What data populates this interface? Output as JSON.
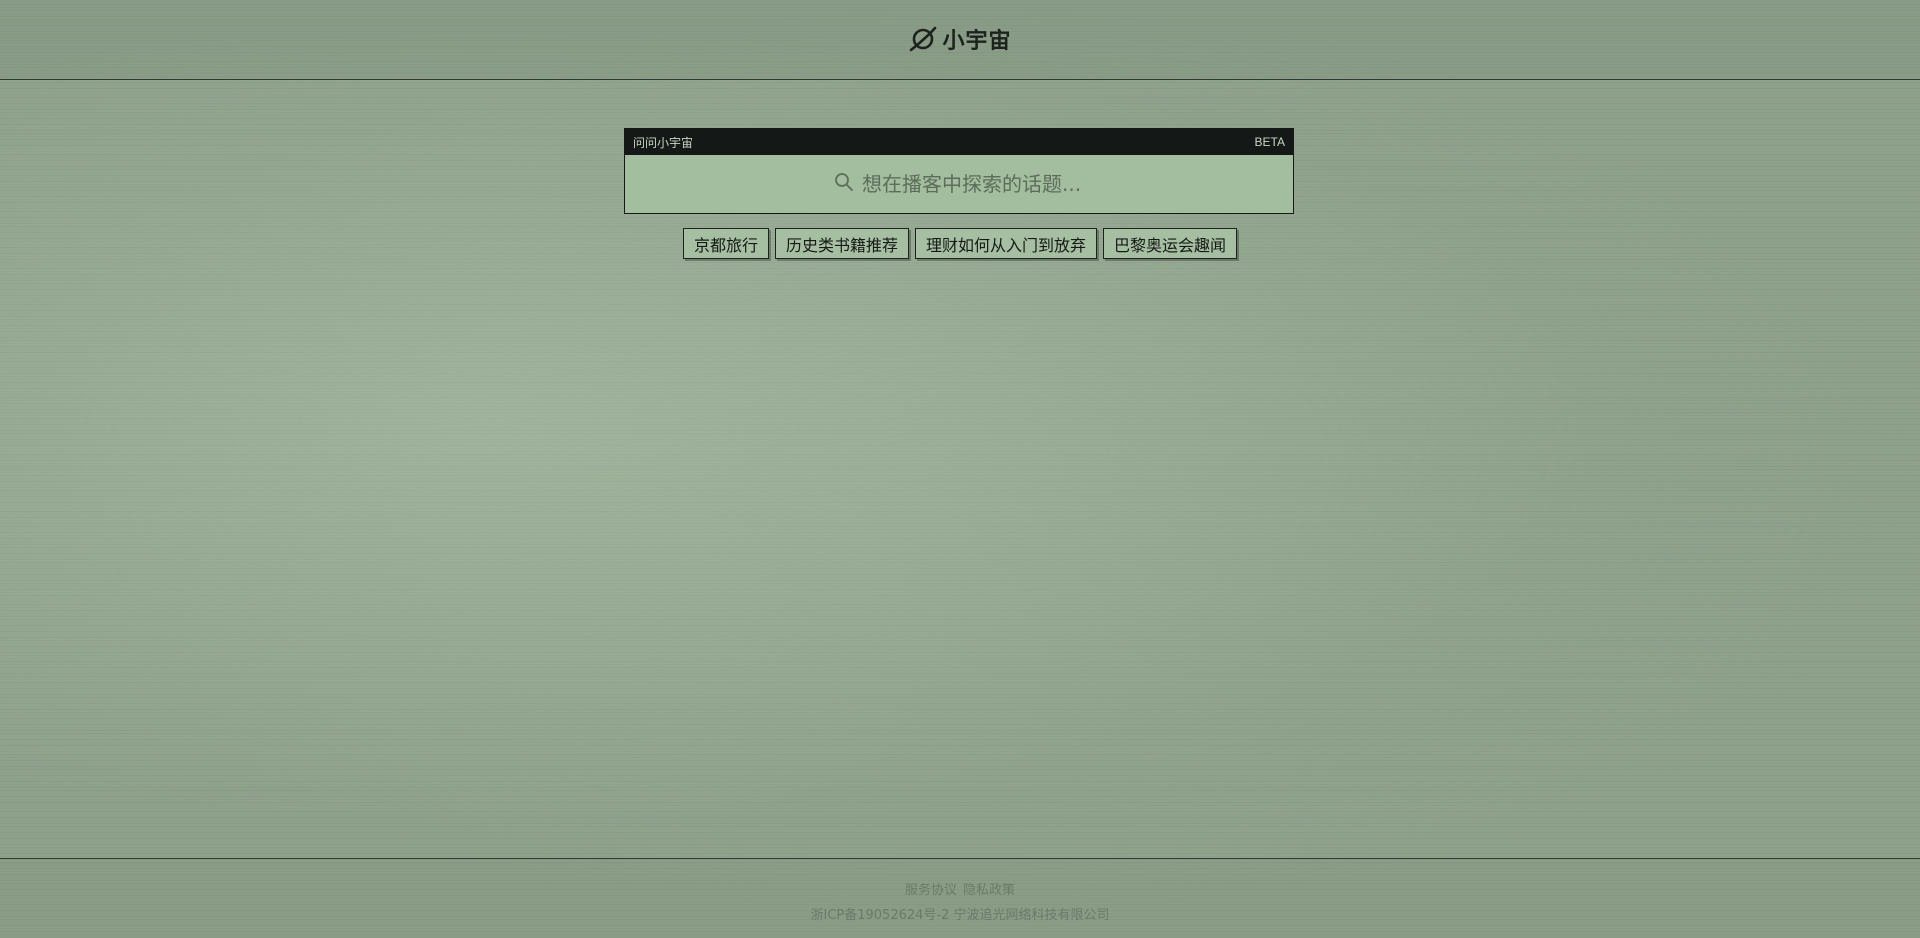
{
  "header": {
    "logo_text": "小宇宙",
    "logo_icon": "planet-icon"
  },
  "search": {
    "title": "问问小宇宙",
    "badge": "BETA",
    "placeholder": "想在播客中探索的话题...",
    "icon": "search-icon"
  },
  "suggestions": [
    {
      "label": "京都旅行"
    },
    {
      "label": "历史类书籍推荐"
    },
    {
      "label": "理财如何从入门到放弃"
    },
    {
      "label": "巴黎奥运会趣闻"
    }
  ],
  "footer": {
    "terms_label": "服务协议",
    "privacy_label": "隐私政策",
    "icp_text": "浙ICP备19052624号-2 宁波追光网络科技有限公司"
  },
  "colors": {
    "background": "#8fa28c",
    "search_bg": "#a3bd9f",
    "titlebar_bg": "#141816",
    "chip_bg": "#a6bea2"
  }
}
